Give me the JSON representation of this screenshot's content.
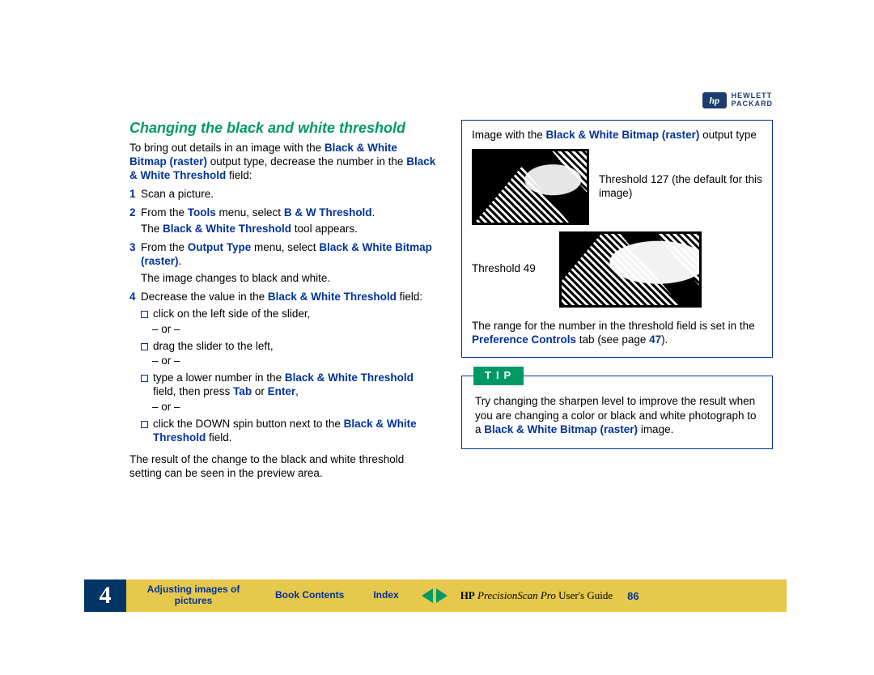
{
  "logo": {
    "mark": "hp",
    "line1": "HEWLETT",
    "line2": "PACKARD"
  },
  "title": "Changing the black and white threshold",
  "intro": {
    "pre": "To bring out details in an image with the ",
    "term1": "Black & White Bitmap (raster)",
    "mid": " output type, decrease the number in the ",
    "term2": "Black & White Threshold",
    "post": " field:"
  },
  "steps": {
    "s1": {
      "n": "1",
      "text": "Scan a picture."
    },
    "s2": {
      "n": "2",
      "pre": "From the ",
      "t1": "Tools",
      "mid": " menu, select ",
      "t2": "B & W Threshold",
      "post": "."
    },
    "s2sub": {
      "pre": "The ",
      "t": "Black & White Threshold",
      "post": " tool appears."
    },
    "s3": {
      "n": "3",
      "pre": "From the ",
      "t1": "Output Type",
      "mid": " menu, select ",
      "t2": "Black & White Bitmap (raster)",
      "post": "."
    },
    "s3sub": "The image changes to black and white.",
    "s4": {
      "n": "4",
      "pre": "Decrease the value in the ",
      "t": "Black & White Threshold",
      "post": " field:"
    }
  },
  "bullets": {
    "b1": "click on the left side of the slider,",
    "or": "– or –",
    "b2": "drag the slider to the left,",
    "b3": {
      "pre": "type a lower number in the ",
      "t1": "Black & White Threshold",
      "mid": " field, then press ",
      "t2": "Tab",
      "mid2": " or ",
      "t3": "Enter",
      "post": ","
    },
    "b4": {
      "pre": "click the DOWN spin button next to the ",
      "t": "Black & White Threshold",
      "post": " field."
    }
  },
  "result": "The result of the change to the black and white threshold setting can be seen in the preview area.",
  "example": {
    "head": {
      "pre": "Image with the ",
      "t": "Black & White Bitmap (raster)",
      "post": " output type"
    },
    "row1": "Threshold 127 (the default for this image)",
    "row2": "Threshold 49",
    "range": {
      "pre": "The range for the number in the threshold field is set in the ",
      "t": "Preference Controls",
      "mid": " tab (see page ",
      "pg": "47",
      "post": ")."
    }
  },
  "tip": {
    "label": "TIP",
    "pre": "Try changing the sharpen level to improve the result when you are changing a color or black and white photograph to a ",
    "t": "Black & White Bitmap (raster)",
    "post": " image."
  },
  "footer": {
    "chapter": "4",
    "section": "Adjusting images of pictures",
    "book": "Book Contents",
    "index": "Index",
    "guide_hp": "HP",
    "guide_ital": " PrecisionScan Pro ",
    "guide_rest": "User's Guide",
    "page": "86"
  }
}
